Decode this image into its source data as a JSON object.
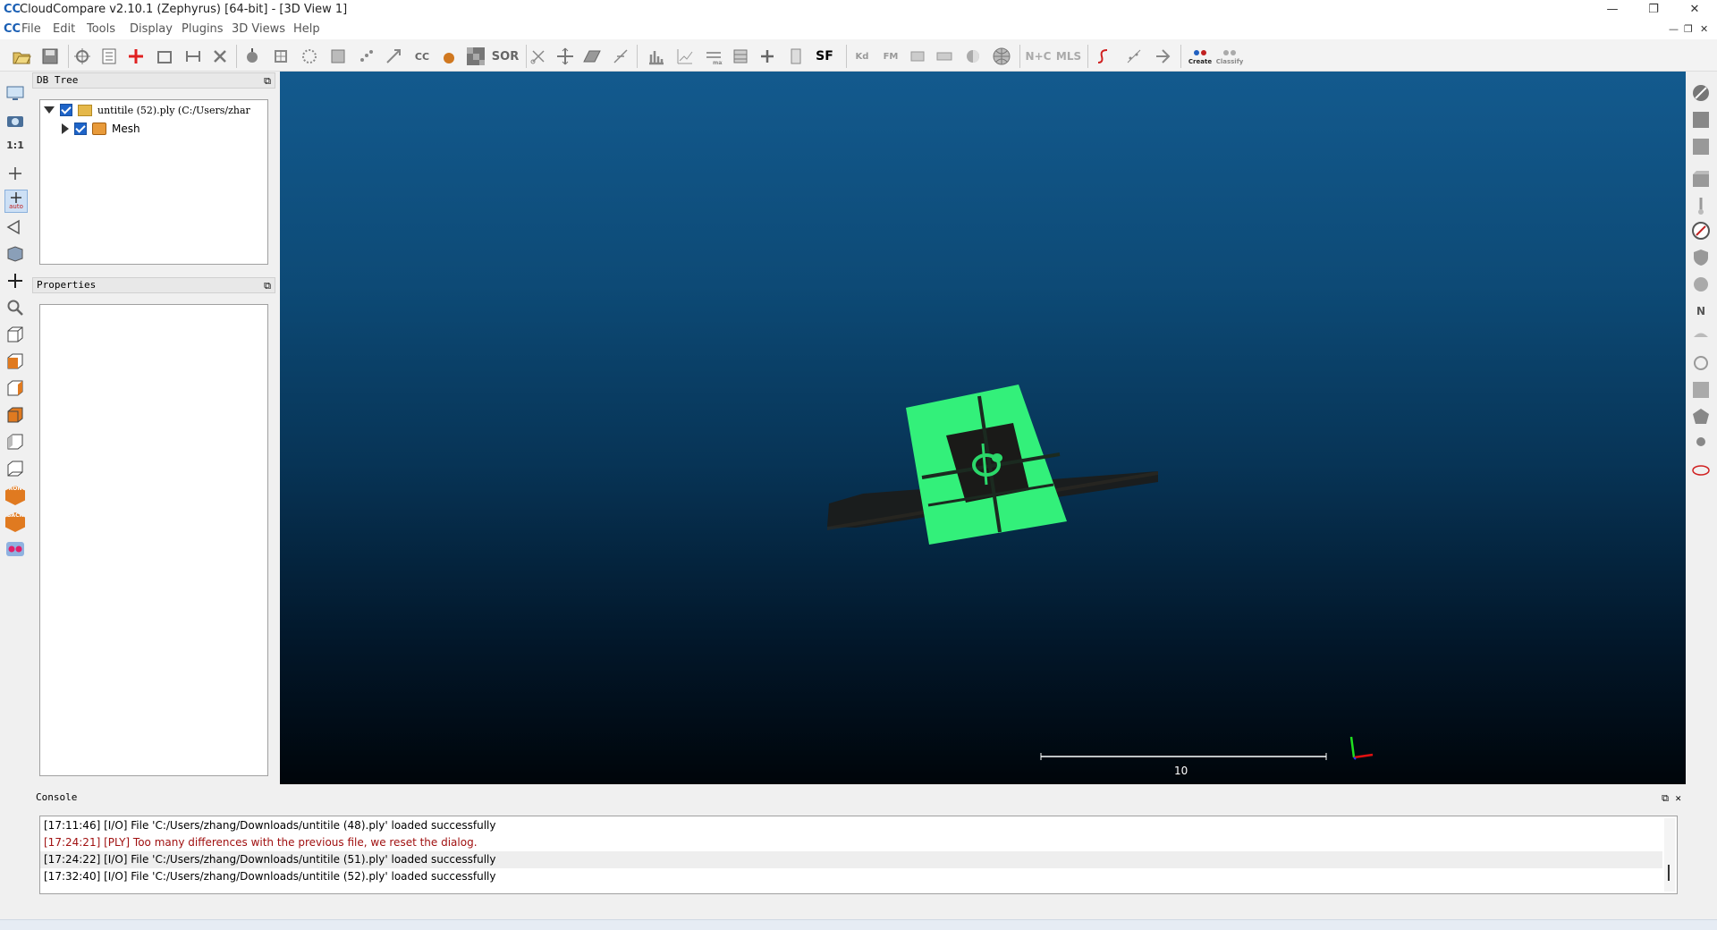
{
  "window": {
    "title": "CloudCompare v2.10.1 (Zephyrus) [64-bit] - [3D View 1]",
    "app_icon": "CC",
    "controls": [
      "—",
      "❐",
      "✕"
    ]
  },
  "menu": {
    "items": [
      "File",
      "Edit",
      "Tools",
      "Display",
      "Plugins",
      "3D Views",
      "Help"
    ],
    "mdi_controls": [
      "—",
      "❐",
      "✕"
    ]
  },
  "toolbar": {
    "text_buttons": {
      "cc": "CC",
      "sor": "SOR",
      "sf": "SF",
      "kd": "Kd",
      "fm": "FM",
      "nc": "N+C",
      "mls": "MLS",
      "canupo_create": "Create",
      "canupo_classify": "Classify"
    }
  },
  "left_toolbar": {
    "one_to_one": "1:1",
    "auto": "auto",
    "front": "FRONT",
    "back": "BACK"
  },
  "right_toolbar": {
    "north": "N"
  },
  "db_tree": {
    "header": "DB Tree",
    "root_label": "untitile (52).ply (C:/Users/zhar",
    "child_label": "Mesh"
  },
  "properties": {
    "header": "Properties"
  },
  "view3d": {
    "scale_label": "10",
    "colors": {
      "mesh_green": "#33f07a",
      "dark": "#1a1a18"
    }
  },
  "console": {
    "header": "Console",
    "lines": [
      {
        "text": "[17:11:46] [I/O] File 'C:/Users/zhang/Downloads/untitile (48).ply' loaded successfully",
        "color": "#000000"
      },
      {
        "text": "[17:24:21] [PLY] Too many differences with the previous file, we reset the dialog.",
        "color": "#a01010"
      },
      {
        "text": "[17:24:22] [I/O] File 'C:/Users/zhang/Downloads/untitile (51).ply' loaded successfully",
        "color": "#000000"
      },
      {
        "text": "[17:32:40] [I/O] File 'C:/Users/zhang/Downloads/untitile (52).ply' loaded successfully",
        "color": "#000000"
      }
    ]
  }
}
